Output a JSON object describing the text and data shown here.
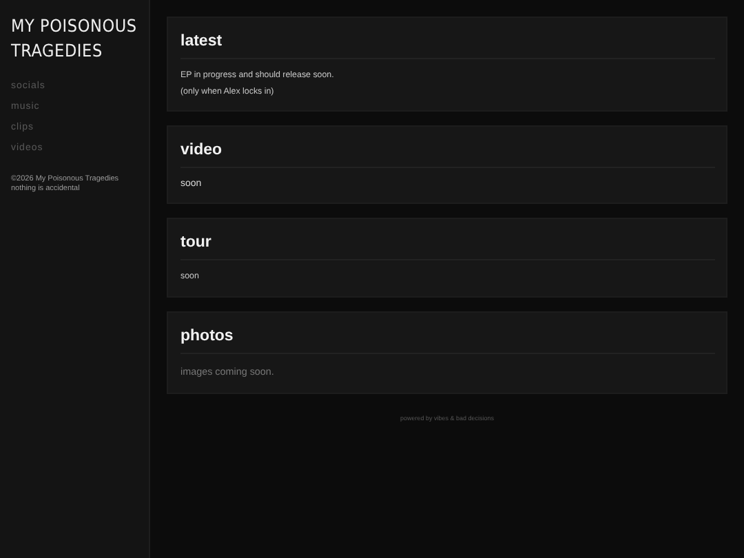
{
  "sidebar": {
    "title": "MY POISONOUS TRAGEDIES",
    "nav": [
      {
        "label": "socials"
      },
      {
        "label": "music"
      },
      {
        "label": "clips"
      },
      {
        "label": "videos"
      }
    ],
    "footer": [
      "©2026 My Poisonous Tragedies",
      "nothing is accidental"
    ]
  },
  "sections": [
    {
      "heading": "latest",
      "kind": "small",
      "lines": [
        "EP in progress and should release soon.",
        "(only when Alex locks in)"
      ]
    },
    {
      "heading": "video",
      "kind": "normal",
      "lines": [
        "soon"
      ]
    },
    {
      "heading": "tour",
      "kind": "small",
      "lines": [
        "soon"
      ]
    },
    {
      "heading": "photos",
      "kind": "muted",
      "lines": [
        "images coming soon."
      ]
    }
  ],
  "footer": "powered by vibes & bad decisions"
}
